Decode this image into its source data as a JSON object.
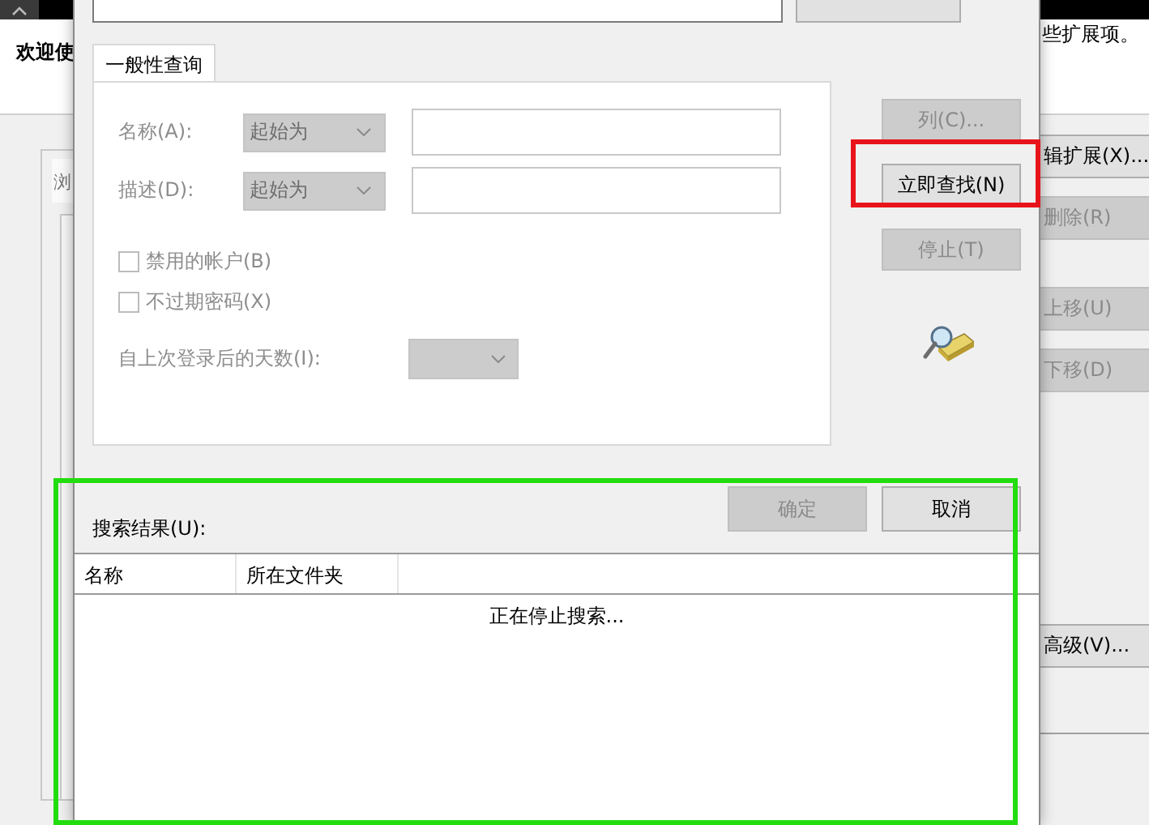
{
  "background_window": {
    "title_fragment": "欢迎使",
    "message_fragment": "些扩展项。",
    "tab_fragment": "浏",
    "buttons": [
      {
        "label": "辑扩展(X)...",
        "disabled": false
      },
      {
        "label": "删除(R)",
        "disabled": true
      },
      {
        "label": "上移(U)",
        "disabled": true
      },
      {
        "label": "下移(D)",
        "disabled": true
      },
      {
        "label": "高级(V)...",
        "disabled": false
      }
    ]
  },
  "dialog": {
    "tabs": [
      {
        "label": "一般性查询",
        "selected": true
      }
    ],
    "fields": [
      {
        "label": "名称(A):",
        "match": "起始为",
        "disabled": true
      },
      {
        "label": "描述(D):",
        "match": "起始为",
        "disabled": true
      }
    ],
    "checkboxes": [
      {
        "label": "禁用的帐户(B)",
        "checked": false,
        "disabled": true
      },
      {
        "label": "不过期密码(X)",
        "checked": false,
        "disabled": true
      }
    ],
    "days": {
      "label": "自上次登录后的天数(I):",
      "disabled": true
    },
    "side_buttons": [
      {
        "label": "列(C)...",
        "disabled": true
      },
      {
        "label": "立即查找(N)",
        "disabled": false
      },
      {
        "label": "停止(T)",
        "disabled": true
      }
    ],
    "footer_buttons": [
      {
        "label": "确定",
        "disabled": true
      },
      {
        "label": "取消",
        "disabled": false
      }
    ],
    "results": {
      "label": "搜索结果(U):",
      "columns": [
        "名称",
        "所在文件夹"
      ],
      "status": "正在停止搜索..."
    }
  },
  "annotations": [
    {
      "kind": "box",
      "color": "#e8141b"
    },
    {
      "kind": "box",
      "color": "#22dd0e"
    }
  ]
}
